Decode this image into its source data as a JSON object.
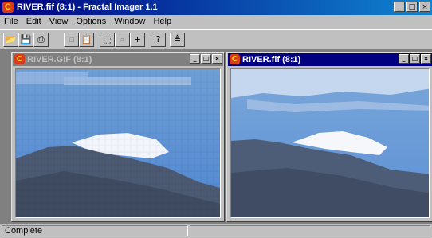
{
  "app": {
    "title": "RIVER.fif (8:1) - Fractal Imager 1.1",
    "icon": "fractal-imager-app-icon"
  },
  "window_buttons": {
    "minimize": "_",
    "maximize": "□",
    "close": "×"
  },
  "menu": [
    {
      "label": "File",
      "mnemonic": "F"
    },
    {
      "label": "Edit",
      "mnemonic": "E"
    },
    {
      "label": "View",
      "mnemonic": "V"
    },
    {
      "label": "Options",
      "mnemonic": "O"
    },
    {
      "label": "Window",
      "mnemonic": "W"
    },
    {
      "label": "Help",
      "mnemonic": "H"
    }
  ],
  "toolbar": [
    {
      "name": "open-icon",
      "glyph": "📂",
      "enabled": true
    },
    {
      "name": "save-icon",
      "glyph": "💾",
      "enabled": true
    },
    {
      "name": "print-icon",
      "glyph": "⎙",
      "enabled": true
    },
    {
      "name": "copy-icon",
      "glyph": "⧉",
      "enabled": false
    },
    {
      "name": "paste-icon",
      "glyph": "📋",
      "enabled": false
    },
    {
      "name": "select-icon",
      "glyph": "⬚",
      "enabled": true
    },
    {
      "name": "zoom-icon",
      "glyph": "⌕",
      "enabled": false
    },
    {
      "name": "zoom-in-icon",
      "glyph": "+",
      "enabled": true
    },
    {
      "name": "help-icon",
      "glyph": "?",
      "enabled": true
    },
    {
      "name": "decompress-icon",
      "glyph": "≜",
      "enabled": true
    }
  ],
  "windows": [
    {
      "title": "RIVER.GIF (8:1)",
      "active": false
    },
    {
      "title": "RIVER.fif (8:1)",
      "active": true
    }
  ],
  "status": {
    "text": "Complete"
  },
  "colors": {
    "titlebar": "#000080",
    "face": "#c0c0c0",
    "workspace": "#808080"
  }
}
